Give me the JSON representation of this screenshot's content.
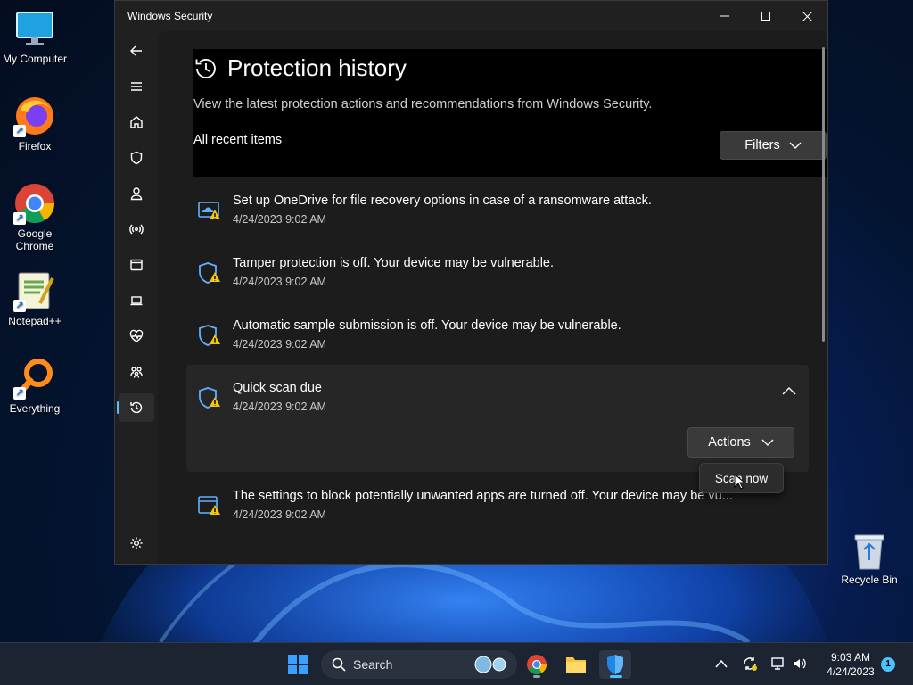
{
  "desktop": {
    "icons": [
      {
        "label": "My Computer"
      },
      {
        "label": "Firefox"
      },
      {
        "label": "Google Chrome"
      },
      {
        "label": "Notepad++"
      },
      {
        "label": "Everything"
      }
    ],
    "recycle_bin": "Recycle Bin"
  },
  "window": {
    "title": "Windows Security",
    "page_title": "Protection history",
    "description": "View the latest protection actions and recommendations from Windows Security.",
    "section_label": "All recent items",
    "filters_label": "Filters",
    "items": [
      {
        "message": "Set up OneDrive for file recovery options in case of a ransomware attack.",
        "timestamp": "4/24/2023 9:02 AM"
      },
      {
        "message": "Tamper protection is off. Your device may be vulnerable.",
        "timestamp": "4/24/2023 9:02 AM"
      },
      {
        "message": "Automatic sample submission is off. Your device may be vulnerable.",
        "timestamp": "4/24/2023 9:02 AM"
      },
      {
        "message": "Quick scan due",
        "timestamp": "4/24/2023 9:02 AM"
      },
      {
        "message": "The settings to block potentially unwanted apps are turned off. Your device may be vu...",
        "timestamp": "4/24/2023 9:02 AM"
      }
    ],
    "actions_label": "Actions",
    "actions_menu_item": "Scan now"
  },
  "taskbar": {
    "search_placeholder": "Search",
    "time": "9:03 AM",
    "date": "4/24/2023",
    "notification_count": "1"
  },
  "colors": {
    "accent": "#4cc2ff",
    "warning": "#f2c811",
    "shield": "#60b0ff"
  }
}
